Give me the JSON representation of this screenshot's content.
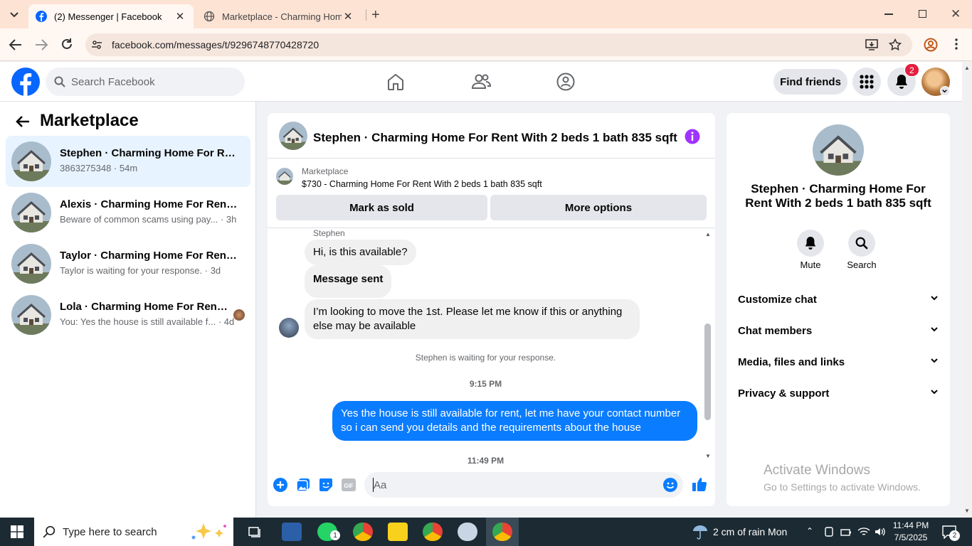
{
  "browser": {
    "tabs": [
      {
        "title": "(2) Messenger | Facebook",
        "active": true
      },
      {
        "title": "Marketplace - Charming Home",
        "active": false
      }
    ],
    "url": "facebook.com/messages/t/9296748770428720"
  },
  "fb": {
    "search_placeholder": "Search Facebook",
    "find_friends": "Find friends",
    "notification_count": "2"
  },
  "sidebar": {
    "title": "Marketplace",
    "conversations": [
      {
        "name": "Stephen · Charming Home For Ren...",
        "preview": "3863275348 · 54m",
        "selected": true
      },
      {
        "name": "Alexis · Charming Home For Rent ...",
        "preview": "Beware of common scams using pay... · 3h"
      },
      {
        "name": "Taylor · Charming Home For Rent ...",
        "preview": "Taylor is waiting for your response. · 3d"
      },
      {
        "name": "Lola · Charming Home For Rent ...",
        "preview": "You: Yes the house is still available f... · 4d"
      }
    ]
  },
  "chat": {
    "title": "Stephen · Charming Home For Rent With 2 beds 1 bath 835 sqft",
    "listing_label": "Marketplace",
    "listing_text": "$730 - Charming Home For Rent With 2 beds 1 bath 835 sqft",
    "mark_sold": "Mark as sold",
    "more_options": "More options",
    "sender": "Stephen",
    "msg1": "Hi, is this available?",
    "msg2": "Message sent",
    "msg3_line1": "I’m looking to move the 1st. Please let me know if this or anything",
    "msg3_line2": "else may be available",
    "waiting": "Stephen is waiting for your response.",
    "time1": "9:15 PM",
    "reply_line1": "Yes the house is still available for rent, let me have your contact number",
    "reply_line2": "so i can send you details and the requirements about the house",
    "time2": "11:49 PM",
    "composer_placeholder": "Aa"
  },
  "info": {
    "title_line1": "Stephen · Charming Home For",
    "title_line2": "Rent With 2 beds 1 bath 835 sqft",
    "mute": "Mute",
    "search": "Search",
    "sections": [
      "Customize chat",
      "Chat members",
      "Media, files and links",
      "Privacy & support"
    ],
    "activate_title": "Activate Windows",
    "activate_sub": "Go to Settings to activate Windows."
  },
  "taskbar": {
    "search_placeholder": "Type here to search",
    "weather": "2 cm of rain Mon",
    "time": "11:44 PM",
    "date": "7/5/2025",
    "notif_count": "2",
    "whatsapp_badge": "1"
  },
  "colors": {
    "fb_blue": "#0866ff",
    "messenger_blue": "#0a7cff",
    "accent_purple": "#a033ff"
  }
}
